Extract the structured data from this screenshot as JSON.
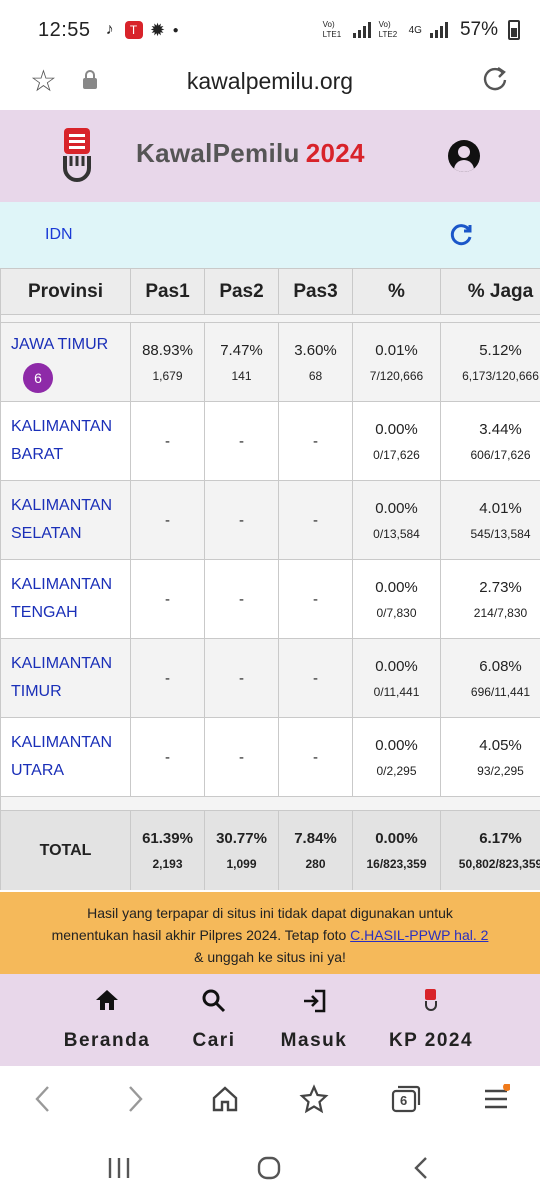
{
  "status_bar": {
    "time": "12:55",
    "sim1": "Vo) LTE1",
    "sim2": "Vo) LTE2",
    "network": "4G",
    "battery": "57%"
  },
  "browser": {
    "url": "kawalpemilu.org"
  },
  "header": {
    "brand": "KawalPemilu",
    "year": "2024"
  },
  "region": {
    "code": "IDN"
  },
  "table": {
    "columns": [
      "Provinsi",
      "Pas1",
      "Pas2",
      "Pas3",
      "%",
      "% Jaga"
    ],
    "rows": [
      {
        "name_line1": "JAWA TIMUR",
        "name_line2": "",
        "badge": "6",
        "pas1_pct": "88.93%",
        "pas1_cnt": "1,679",
        "pas2_pct": "7.47%",
        "pas2_cnt": "141",
        "pas3_pct": "3.60%",
        "pas3_cnt": "68",
        "pct": "0.01%",
        "pct_cnt": "7/120,666",
        "jaga": "5.12%",
        "jaga_cnt": "6,173/120,666"
      },
      {
        "name_line1": "KALIMANTAN",
        "name_line2": "BARAT",
        "badge": "",
        "pas1_pct": "-",
        "pas2_pct": "-",
        "pas3_pct": "-",
        "pct": "0.00%",
        "pct_cnt": "0/17,626",
        "jaga": "3.44%",
        "jaga_cnt": "606/17,626"
      },
      {
        "name_line1": "KALIMANTAN",
        "name_line2": "SELATAN",
        "badge": "",
        "pas1_pct": "-",
        "pas2_pct": "-",
        "pas3_pct": "-",
        "pct": "0.00%",
        "pct_cnt": "0/13,584",
        "jaga": "4.01%",
        "jaga_cnt": "545/13,584"
      },
      {
        "name_line1": "KALIMANTAN",
        "name_line2": "TENGAH",
        "badge": "",
        "pas1_pct": "-",
        "pas2_pct": "-",
        "pas3_pct": "-",
        "pct": "0.00%",
        "pct_cnt": "0/7,830",
        "jaga": "2.73%",
        "jaga_cnt": "214/7,830"
      },
      {
        "name_line1": "KALIMANTAN",
        "name_line2": "TIMUR",
        "badge": "",
        "pas1_pct": "-",
        "pas2_pct": "-",
        "pas3_pct": "-",
        "pct": "0.00%",
        "pct_cnt": "0/11,441",
        "jaga": "6.08%",
        "jaga_cnt": "696/11,441"
      },
      {
        "name_line1": "KALIMANTAN",
        "name_line2": "UTARA",
        "badge": "",
        "pas1_pct": "-",
        "pas2_pct": "-",
        "pas3_pct": "-",
        "pct": "0.00%",
        "pct_cnt": "0/2,295",
        "jaga": "4.05%",
        "jaga_cnt": "93/2,295"
      }
    ],
    "total": {
      "label": "TOTAL",
      "pas1_pct": "61.39%",
      "pas1_cnt": "2,193",
      "pas2_pct": "30.77%",
      "pas2_cnt": "1,099",
      "pas3_pct": "7.84%",
      "pas3_cnt": "280",
      "pct": "0.00%",
      "pct_cnt": "16/823,359",
      "jaga": "6.17%",
      "jaga_cnt": "50,802/823,359"
    }
  },
  "notice": {
    "line1": "Hasil yang terpapar di situs ini tidak dapat digunakan untuk",
    "line2_prefix": "menentukan hasil akhir Pilpres 2024. Tetap foto ",
    "link": "C.HASIL-PPWP hal. 2",
    "line3": "& unggah ke situs ini ya!"
  },
  "nav": {
    "home": "Beranda",
    "search": "Cari",
    "login": "Masuk",
    "kp": "KP 2024"
  },
  "browser_bar": {
    "tabs_count": "6"
  },
  "colors": {
    "header_bg": "#e8d7ea",
    "region_bg": "#dff5f8",
    "notice_bg": "#f5b95a",
    "brand_year": "#d8232a",
    "link_blue": "#1a2fb8",
    "badge_purple": "#8e2aa8"
  }
}
